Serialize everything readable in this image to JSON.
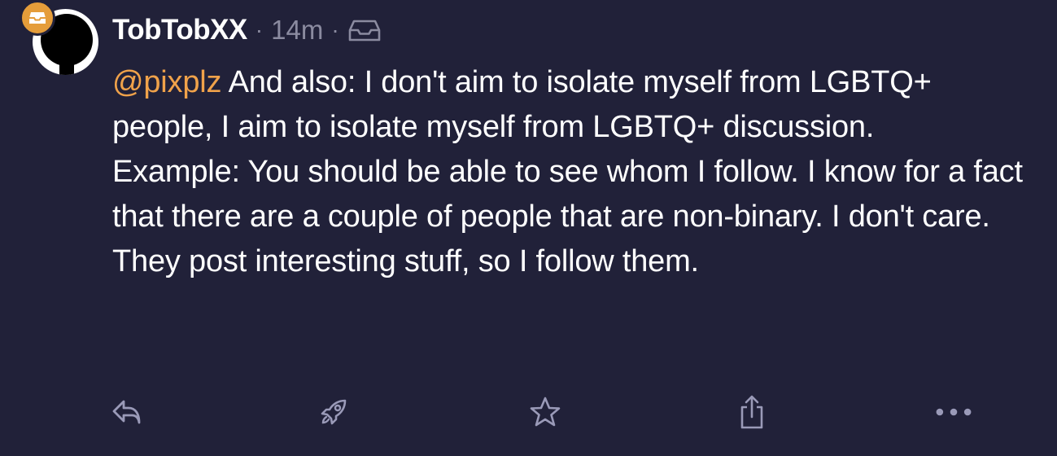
{
  "post": {
    "username": "TobTobXX",
    "separator": "·",
    "time": "14m",
    "visibility_icon": "inbox-icon",
    "mention": "@pixplz",
    "text_line1_rest": " And also: I don't aim to isolate myself from LGBTQ+ people, I aim to isolate myself from LGBTQ+ discussion.",
    "text_para2": "Example: You should be able to see whom I follow. I know for a fact that there are a couple of people that are non-binary. I don't care. They post interesting stuff, so I follow them."
  },
  "actions": [
    "reply-icon",
    "boost-icon",
    "favourite-icon",
    "share-icon",
    "more-icon"
  ],
  "colors": {
    "background": "#212139",
    "mention": "#f0a24a",
    "badge": "#e59d3a",
    "muted": "#8b8ba0",
    "icon": "#9a9ab8"
  }
}
